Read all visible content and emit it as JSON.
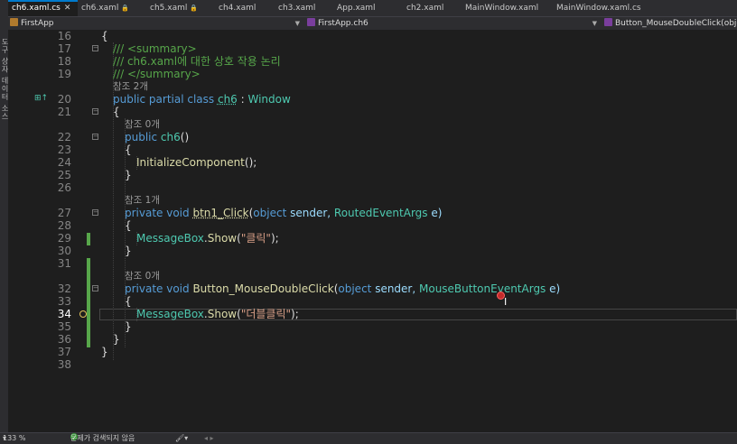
{
  "sidebar": {
    "label": "도구 상자 데이터 소스"
  },
  "tabs": [
    {
      "label": "ch6.xaml.cs",
      "active": true,
      "close": "✕"
    },
    {
      "label": "ch6.xaml",
      "lock": "🔒"
    },
    {
      "label": "ch5.xaml",
      "lock": "🔒"
    },
    {
      "label": "ch4.xaml"
    },
    {
      "label": "ch3.xaml"
    },
    {
      "label": "App.xaml"
    },
    {
      "label": "ch2.xaml"
    },
    {
      "label": "MainWindow.xaml"
    },
    {
      "label": "MainWindow.xaml.cs"
    }
  ],
  "navbar": {
    "project": "FirstApp",
    "class": "FirstApp.ch6",
    "member": "Button_MouseDoubleClick(object sende"
  },
  "code": {
    "line_numbers": [
      "16",
      "17",
      "18",
      "19",
      "20",
      "21",
      "22",
      "23",
      "24",
      "25",
      "26",
      "27",
      "28",
      "29",
      "30",
      "31",
      "32",
      "33",
      "34",
      "35",
      "36",
      "37",
      "38"
    ],
    "refs": {
      "class_refs": "참조 2개",
      "ctor_refs": "참조 0개",
      "btn1_refs": "참조 1개",
      "dbl_refs": "참조 0개"
    },
    "l16": "{",
    "l17_comment": "/// <summary>",
    "l18_comment": "/// ch6.xaml에 대한 상호 작용 논리",
    "l19_comment": "/// </summary>",
    "l20_kw": "public partial class ",
    "l20_name": "ch6",
    "l20_sep": " : ",
    "l20_base": "Window",
    "l21": "{",
    "l22_kw": "public ",
    "l22_name": "ch6",
    "l22_rest": "()",
    "l23": "{",
    "l24_fn": "InitializeComponent",
    "l24_rest": "();",
    "l25": "}",
    "l27_kw": "private void ",
    "l27_fn": "btn1_Click",
    "l27_p1": "(",
    "l27_kw2": "object",
    "l27_p2": " sender, ",
    "l27_ty": "RoutedEventArgs",
    "l27_p3": " e)",
    "l28": "{",
    "l29_ty": "MessageBox",
    "l29_dot": ".",
    "l29_fn": "Show",
    "l29_p1": "(",
    "l29_str": "\"클릭\"",
    "l29_p2": ");",
    "l30": "}",
    "l32_kw": "private void ",
    "l32_fn": "Button_MouseDoubleClick",
    "l32_p1": "(",
    "l32_kw2": "object",
    "l32_p2": " sender, ",
    "l32_ty": "MouseButtonEventArgs",
    "l32_p3": " e)",
    "l33": "{",
    "l34_ty": "MessageBox",
    "l34_dot": ".",
    "l34_fn": "Show",
    "l34_p1": "(",
    "l34_str": "\"더블클릭\"",
    "l34_p2": ");",
    "l35": "}",
    "l36": "}",
    "l37": "}"
  },
  "status": {
    "zoom": "133 %",
    "zoom_arrow": "▾",
    "issues": "문제가 검색되지 않음",
    "issues_icon": "✓",
    "brush": "🖌▾",
    "nav_arrows": "◂ ▸"
  },
  "colors": {
    "background": "#1e1e1e",
    "keyword": "#569cd6",
    "type": "#4ec9b0",
    "method": "#dcdcaa",
    "comment": "#57a64a",
    "string": "#d69d85",
    "accent": "#007acc"
  }
}
